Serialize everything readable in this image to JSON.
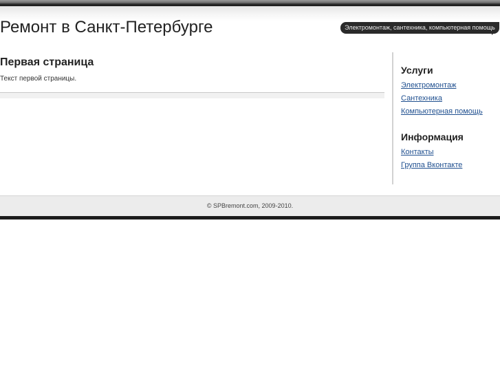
{
  "header": {
    "site_title": "Ремонт в Санкт-Петербурге",
    "tagline": "Электромонтаж, сантехника, компьютерная помощь"
  },
  "main": {
    "page_title": "Первая страница",
    "page_text": "Текст первой страницы."
  },
  "sidebar": {
    "sections": [
      {
        "heading": "Услуги",
        "links": [
          "Электромонтаж",
          "Сантехника",
          "Компьютерная помощь"
        ]
      },
      {
        "heading": "Информация",
        "links": [
          "Контакты",
          "Группа Вконтакте"
        ]
      }
    ]
  },
  "footer": {
    "copyright": "© SPBremont.com, 2009-2010."
  },
  "colors": {
    "link": "#1f4f8f",
    "bar_dark": "#1c1c1c",
    "footer_bg": "#ececec"
  }
}
